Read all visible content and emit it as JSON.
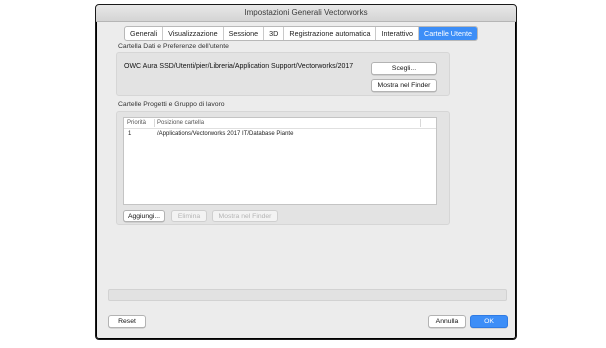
{
  "window": {
    "title": "Impostazioni Generali Vectorworks"
  },
  "tabs": [
    {
      "label": "Generali"
    },
    {
      "label": "Visualizzazione"
    },
    {
      "label": "Sessione"
    },
    {
      "label": "3D"
    },
    {
      "label": "Registrazione automatica"
    },
    {
      "label": "Interattivo"
    },
    {
      "label": "Cartelle Utente",
      "active": true
    }
  ],
  "user_folder": {
    "section_label": "Cartella Dati e Preferenze dell'utente",
    "path": "OWC Aura SSD/Utenti/pier/Libreria/Application Support/Vectorworks/2017",
    "choose_label": "Scegli...",
    "show_in_finder_label": "Mostra nel Finder"
  },
  "project_folders": {
    "section_label": "Cartelle Progetti e Gruppo di lavoro",
    "columns": [
      "Priorità",
      "Posizione cartella"
    ],
    "rows": [
      {
        "priority": "1",
        "location": "/Applications/Vectorworks 2017 IT/Database Piante"
      }
    ],
    "add_label": "Aggiungi...",
    "remove_label": "Elimina",
    "show_in_finder_label": "Mostra nel Finder"
  },
  "footer": {
    "reset_label": "Reset",
    "cancel_label": "Annulla",
    "ok_label": "OK"
  },
  "colors": {
    "accent": "#3d8ef7",
    "window_bg": "#ececec"
  }
}
